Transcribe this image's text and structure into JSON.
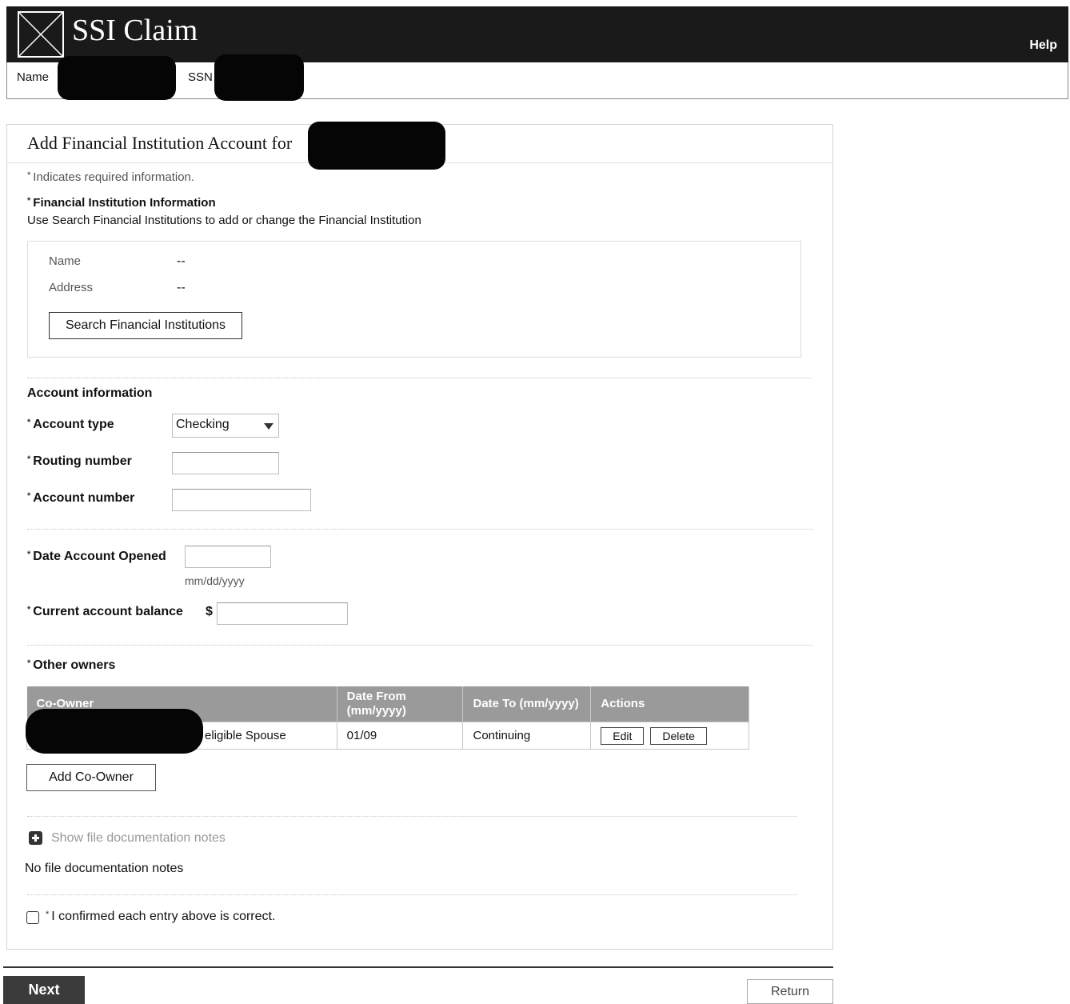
{
  "header": {
    "app_title": "SSI Claim",
    "help_label": "Help",
    "name_label": "Name",
    "ssn_label": "SSN"
  },
  "panel": {
    "title": "Add Financial Institution Account for",
    "required_note": "Indicates required information.",
    "required_marker": "*"
  },
  "financial_institution": {
    "heading": "Financial Institution Information",
    "instruction": "Use Search Financial Institutions to add or change the Financial Institution",
    "name_label": "Name",
    "name_value": "--",
    "address_label": "Address",
    "address_value": "--",
    "search_button": "Search Financial Institutions"
  },
  "account": {
    "heading": "Account information",
    "type_label": "Account type",
    "type_value": "Checking",
    "routing_label": "Routing number",
    "routing_value": "",
    "number_label": "Account number",
    "number_value": "",
    "date_opened_label": "Date Account Opened",
    "date_opened_value": "",
    "date_hint": "mm/dd/yyyy",
    "balance_label": "Current account balance",
    "currency_symbol": "$",
    "balance_value": ""
  },
  "owners": {
    "heading": "Other owners",
    "columns": [
      "Co-Owner",
      "Date From (mm/yyyy)",
      "Date To (mm/yyyy)",
      "Actions"
    ],
    "rows": [
      {
        "co_owner": "eligible Spouse",
        "date_from": "01/09",
        "date_to": "Continuing",
        "edit_label": "Edit",
        "delete_label": "Delete"
      }
    ],
    "add_button": "Add Co-Owner"
  },
  "notes": {
    "toggle_label": "Show file documentation notes",
    "status": "No file documentation notes"
  },
  "confirm": {
    "label": "I confirmed each entry above is correct."
  },
  "footer": {
    "next_label": "Next",
    "return_label": "Return"
  },
  "colors": {
    "header_bg": "#1a1a1a",
    "table_header_bg": "#9a9a9a",
    "next_button_bg": "#3b3b3b"
  }
}
